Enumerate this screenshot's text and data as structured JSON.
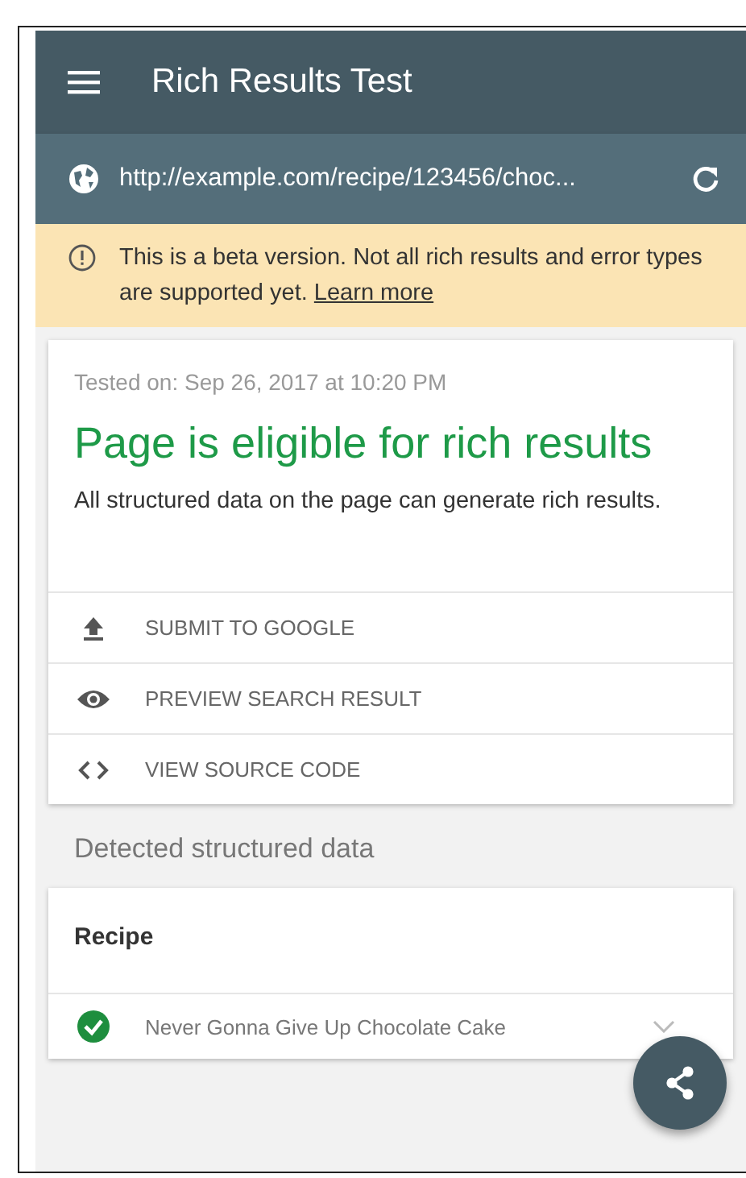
{
  "app_bar": {
    "title": "Rich Results Test"
  },
  "url_bar": {
    "value": "http://example.com/recipe/123456/choc..."
  },
  "banner": {
    "text": "This is a beta version. Not all rich results and error types are supported yet.",
    "link": "Learn more"
  },
  "result_card": {
    "tested_on": "Tested on: Sep 26, 2017 at 10:20 PM",
    "headline": "Page is eligible for rich results",
    "description": "All structured data on the page can generate rich results.",
    "actions": [
      {
        "label": "SUBMIT TO GOOGLE",
        "kind": "upload"
      },
      {
        "label": "PREVIEW SEARCH RESULT",
        "kind": "preview"
      },
      {
        "label": "VIEW SOURCE CODE",
        "kind": "code"
      }
    ]
  },
  "detected": {
    "heading": "Detected structured data",
    "type": "Recipe",
    "items": [
      {
        "name": "Never Gonna Give Up Chocolate Cake",
        "valid": true
      }
    ]
  }
}
